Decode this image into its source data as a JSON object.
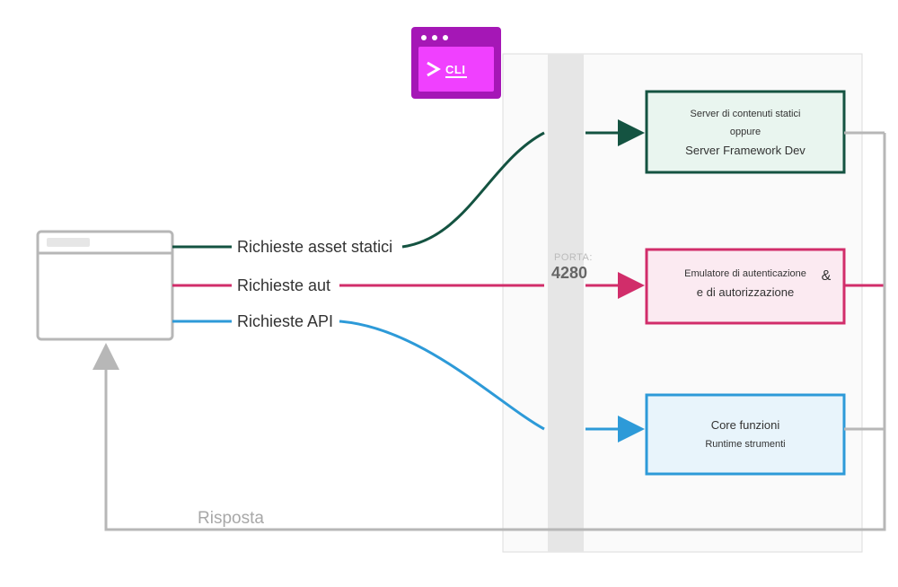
{
  "colors": {
    "green": "#145341",
    "magenta": "#d12d6a",
    "blue": "#2d9ad8",
    "grey": "#b7b7b7",
    "greyFill": "#e6e6e6",
    "cliPurple": "#a517b6",
    "cliInner": "#f040ff",
    "greenFill": "#e9f5ef",
    "magentaFill": "#fbeaf1",
    "blueFill": "#e8f4fb",
    "panelBorder": "#dcdcdc",
    "text": "#555"
  },
  "browser": {
    "icon": "browser-window"
  },
  "cli": {
    "label": "CLI"
  },
  "port": {
    "label": "PORTA:",
    "value": "4280"
  },
  "requests": {
    "static": {
      "label": "Richieste asset statici"
    },
    "auth": {
      "label": "Richieste aut"
    },
    "api": {
      "label": "Richieste API"
    }
  },
  "targets": {
    "static": {
      "line1": "Server di contenuti statici",
      "line2": "oppure",
      "line3": "Server Framework Dev"
    },
    "auth": {
      "line1": "Emulatore di autenticazione",
      "amp": "&",
      "line2": "e di autorizzazione"
    },
    "api": {
      "line1": "Core funzioni",
      "line2": "Runtime strumenti"
    }
  },
  "response": {
    "label": "Risposta"
  }
}
